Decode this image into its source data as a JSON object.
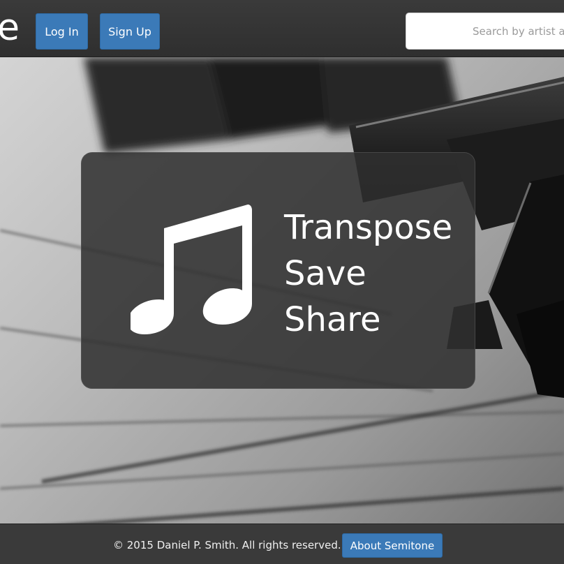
{
  "brand": {
    "visible_text": "e"
  },
  "header": {
    "login_label": "Log In",
    "signup_label": "Sign Up",
    "search": {
      "placeholder": "Search by artist and",
      "value": ""
    }
  },
  "hero": {
    "icon": "music-note-icon",
    "lines": [
      "Transpose",
      "Save",
      "Share"
    ]
  },
  "footer": {
    "copyright": "© 2015 Daniel P. Smith. All rights reserved.",
    "about_label": "About Semitone"
  },
  "colors": {
    "accent": "#3b7ab8",
    "header_bg": "#333333",
    "footer_bg": "#3a3a3a",
    "card_bg": "#303030"
  }
}
